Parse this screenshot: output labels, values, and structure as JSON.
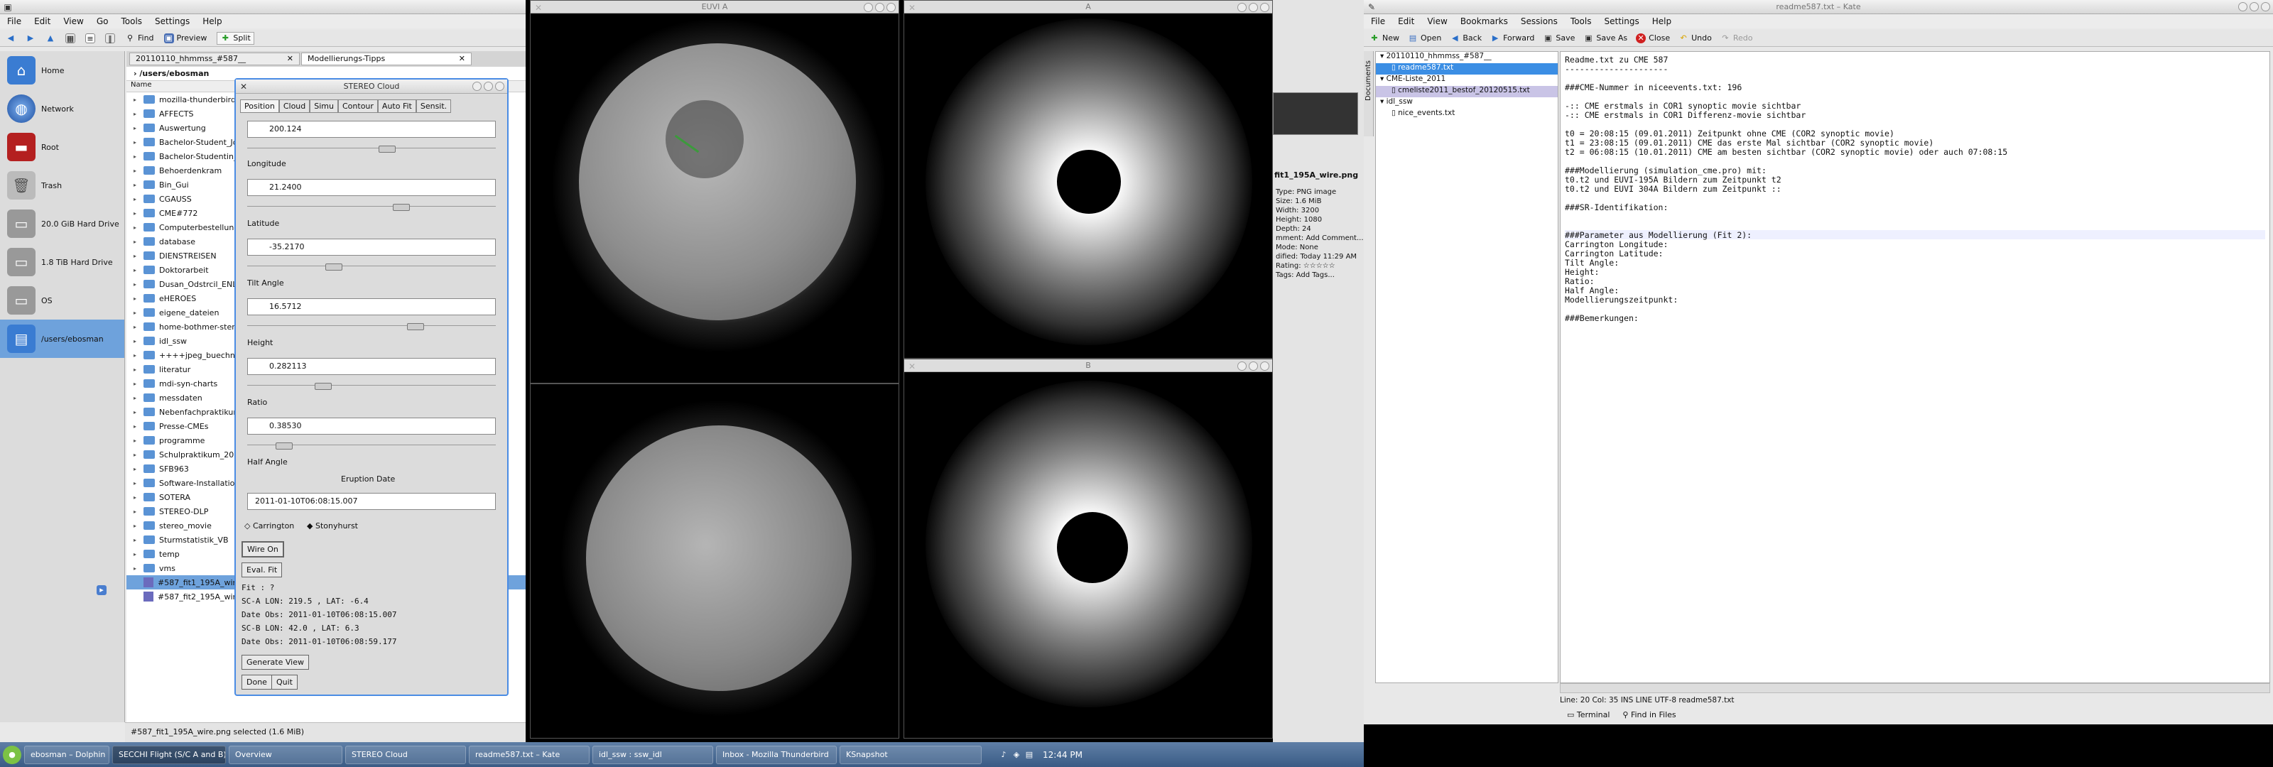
{
  "dolphin": {
    "menu": [
      "File",
      "Edit",
      "View",
      "Go",
      "Tools",
      "Settings",
      "Help"
    ],
    "toolbar": {
      "find": "Find",
      "preview": "Preview",
      "split": "Split"
    },
    "places": [
      {
        "label": "Home",
        "icon": "home-icon"
      },
      {
        "label": "Network",
        "icon": "network-icon"
      },
      {
        "label": "Root",
        "icon": "root-icon"
      },
      {
        "label": "Trash",
        "icon": "trash-icon"
      },
      {
        "label": "20.0 GiB Hard Drive",
        "icon": "hard-drive-icon"
      },
      {
        "label": "1.8 TiB Hard Drive",
        "icon": "hard-drive-icon"
      },
      {
        "label": "OS",
        "icon": "hard-drive-icon"
      },
      {
        "label": "/users/ebosman",
        "icon": "folder-icon"
      }
    ],
    "tabs": [
      "20110110_hhmmss_#587__",
      "Modellierungs-Tipps"
    ],
    "breadcrumb": "/users/ebosman",
    "column_header": "Name",
    "files": [
      "mozilla-thunderbird",
      "AFFECTS",
      "Auswertung",
      "Bachelor-Student_Jol",
      "Bachelor-Studentin_N",
      "Behoerdenkram",
      "Bin_Gui",
      "CGAUSS",
      "CME#772",
      "Computerbestellung",
      "database",
      "DIENSTREISEN",
      "Doktorarbeit",
      "Dusan_Odstrcil_ENLIL",
      "eHEROES",
      "eigene_dateien",
      "home-bothmer-stereo",
      "idl_ssw",
      "++++jpeg_buechner_s",
      "literatur",
      "mdi-syn-charts",
      "messdaten",
      "Nebenfachpraktikum",
      "Presse-CMEs",
      "programme",
      "Schulpraktikum_2011_",
      "SFB963",
      "Software-Installation",
      "SOTERA",
      "STEREO-DLP",
      "stereo_movie",
      "Sturmstatistik_VB",
      "temp",
      "vms"
    ],
    "image_files": [
      "#587_fit1_195A_wire.png",
      "#587_fit2_195A_wire.png"
    ],
    "status": "#587_fit1_195A_wire.png selected (1.6 MiB)"
  },
  "stereo": {
    "title": "STEREO Cloud",
    "tabs": [
      "Position",
      "Cloud",
      "Simu",
      "Contour",
      "Auto Fit",
      "Sensit."
    ],
    "fields": [
      {
        "label": "",
        "value": "200.124"
      },
      {
        "label": "Longitude",
        "value": "21.2400"
      },
      {
        "label": "Latitude",
        "value": "-35.2170"
      },
      {
        "label": "Tilt Angle",
        "value": "16.5712"
      },
      {
        "label": "Height",
        "value": "0.282113"
      },
      {
        "label": "Ratio",
        "value": "0.38530"
      }
    ],
    "half_angle_label": "Half Angle",
    "eruption_label": "Eruption Date",
    "eruption_value": "2011-01-10T06:08:15.007",
    "radio_carrington": "Carrington",
    "radio_stonyhurst": "Stonyhurst",
    "wire_on": "Wire On",
    "eval_fit": "Eval. Fit",
    "info": [
      "Fit : ?",
      "SC-A LON:  219.5 , LAT:  -6.4",
      "Date Obs: 2011-01-10T06:08:15.007",
      "SC-B LON:   42.0 , LAT:   6.3",
      "Date Obs: 2011-01-10T06:08:59.177"
    ],
    "generate_view": "Generate View",
    "done": "Done",
    "quit": "Quit"
  },
  "panes": {
    "euvi_a_title": "EUVI A",
    "cor_a_title": "A",
    "cor_b_title": "B"
  },
  "preview": {
    "filename": "fit1_195A_wire.png",
    "info": [
      "Type: PNG image",
      "Size: 1.6 MiB",
      "Width: 3200",
      "Height: 1080",
      "Depth: 24",
      "mment: Add Comment...",
      "Mode: None",
      "dified: Today 11:29 AM",
      "Rating: ☆☆☆☆☆",
      "Tags: Add Tags..."
    ]
  },
  "kate": {
    "title": "readme587.txt – Kate",
    "menu": [
      "File",
      "Edit",
      "View",
      "Bookmarks",
      "Sessions",
      "Tools",
      "Settings",
      "Help"
    ],
    "toolbar": [
      "New",
      "Open",
      "Back",
      "Forward",
      "Save",
      "Save As",
      "Close",
      "Undo",
      "Redo"
    ],
    "side_tab": "Documents",
    "tree": [
      {
        "label": "20110110_hhmmss_#587__",
        "level": 0
      },
      {
        "label": "readme587.txt",
        "level": 1,
        "sel": true
      },
      {
        "label": "CME-Liste_2011",
        "level": 0
      },
      {
        "label": "cmeliste2011_bestof_20120515.txt",
        "level": 1,
        "hl": true
      },
      {
        "label": "idl_ssw",
        "level": 0
      },
      {
        "label": "nice_events.txt",
        "level": 1
      }
    ],
    "lines": [
      "Readme.txt zu CME 587",
      "---------------------",
      "",
      "###CME-Nummer in niceevents.txt: 196",
      "",
      "-:: CME erstmals in COR1 synoptic movie sichtbar",
      "-:: CME erstmals in COR1 Differenz-movie sichtbar",
      "",
      "t0 = 20:08:15 (09.01.2011) Zeitpunkt ohne CME (COR2 synoptic movie)",
      "t1 = 23:08:15 (09.01.2011) CME das erste Mal sichtbar (COR2 synoptic movie)",
      "t2 = 06:08:15 (10.01.2011) CME am besten sichtbar (COR2 synoptic movie) oder auch 07:08:15",
      "",
      "###Modellierung (simulation_cme.pro) mit:",
      "t0.t2 und EUVI-195A Bildern zum Zeitpunkt t2",
      "t0.t2 und EUVI 304A Bildern zum Zeitpunkt ::",
      "",
      "###SR-Identifikation:",
      "",
      "",
      "###Parameter aus Modellierung (Fit 2):",
      "Carrington Longitude:",
      "Carrington Latitude:",
      "Tilt Angle:",
      "Height:",
      "Ratio:",
      "Half Angle:",
      "Modellierungszeitpunkt:",
      "",
      "###Bemerkungen:"
    ],
    "status": "Line: 20 Col: 35        INS  LINE  UTF-8  readme587.txt",
    "bottom_tabs": [
      "Terminal",
      "Find in Files"
    ]
  },
  "taskbar": {
    "tasks": [
      "ebosman – Dolphin",
      "SECCHI Flight (S/C A and B)",
      "Overview",
      "STEREO Cloud",
      "readme587.txt – Kate",
      "idl_ssw : ssw_idl",
      "Inbox - Mozilla Thunderbird",
      "KSnapshot"
    ],
    "clock": "12:44 PM"
  }
}
